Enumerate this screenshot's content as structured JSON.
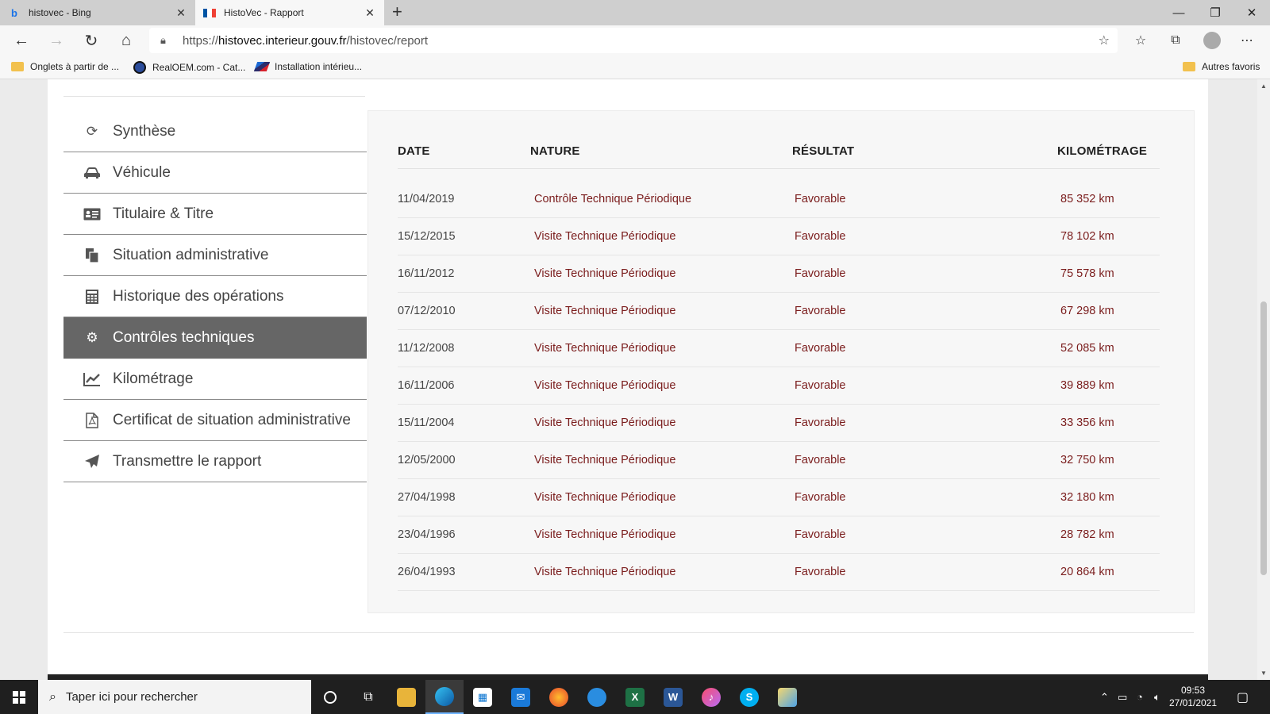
{
  "browser": {
    "tabs": [
      {
        "title": "histovec - Bing",
        "favicon": "bing-icon",
        "active": false
      },
      {
        "title": "HistoVec - Rapport",
        "favicon": "french-flag-icon",
        "active": true
      }
    ],
    "url": {
      "scheme": "https://",
      "host": "histovec.interieur.gouv.fr",
      "path": "/histovec/report"
    },
    "favorites": [
      {
        "label": "Onglets à partir de ...",
        "icon": "folder-icon"
      },
      {
        "label": "RealOEM.com - Cat...",
        "icon": "bmw-icon"
      },
      {
        "label": "Installation intérieu...",
        "icon": "m-stripes-icon"
      }
    ],
    "other_favorites": "Autres favoris"
  },
  "sidebar": {
    "items": [
      {
        "label": "Synthèse",
        "icon": "refresh-icon",
        "active": false
      },
      {
        "label": "Véhicule",
        "icon": "car-icon",
        "active": false
      },
      {
        "label": "Titulaire & Titre",
        "icon": "id-card-icon",
        "active": false
      },
      {
        "label": "Situation administrative",
        "icon": "document-copy-icon",
        "active": false
      },
      {
        "label": "Historique des opérations",
        "icon": "calculator-icon",
        "active": false
      },
      {
        "label": "Contrôles techniques",
        "icon": "gears-icon",
        "active": true
      },
      {
        "label": "Kilométrage",
        "icon": "line-chart-icon",
        "active": false
      },
      {
        "label": "Certificat de situation administrative",
        "icon": "pdf-icon",
        "active": false
      },
      {
        "label": "Transmettre le rapport",
        "icon": "paper-plane-icon",
        "active": false
      }
    ]
  },
  "table": {
    "headers": {
      "date": "DATE",
      "nature": "NATURE",
      "result": "RÉSULTAT",
      "mileage": "KILOMÉTRAGE"
    },
    "rows": [
      {
        "date": "11/04/2019",
        "nature": "Contrôle Technique Périodique",
        "result": "Favorable",
        "mileage": "85 352 km"
      },
      {
        "date": "15/12/2015",
        "nature": "Visite Technique Périodique",
        "result": "Favorable",
        "mileage": "78 102 km"
      },
      {
        "date": "16/11/2012",
        "nature": "Visite Technique Périodique",
        "result": "Favorable",
        "mileage": "75 578 km"
      },
      {
        "date": "07/12/2010",
        "nature": "Visite Technique Périodique",
        "result": "Favorable",
        "mileage": "67 298 km"
      },
      {
        "date": "11/12/2008",
        "nature": "Visite Technique Périodique",
        "result": "Favorable",
        "mileage": "52 085 km"
      },
      {
        "date": "16/11/2006",
        "nature": "Visite Technique Périodique",
        "result": "Favorable",
        "mileage": "39 889 km"
      },
      {
        "date": "15/11/2004",
        "nature": "Visite Technique Périodique",
        "result": "Favorable",
        "mileage": "33 356 km"
      },
      {
        "date": "12/05/2000",
        "nature": "Visite Technique Périodique",
        "result": "Favorable",
        "mileage": "32 750 km"
      },
      {
        "date": "27/04/1998",
        "nature": "Visite Technique Périodique",
        "result": "Favorable",
        "mileage": "32 180 km"
      },
      {
        "date": "23/04/1996",
        "nature": "Visite Technique Périodique",
        "result": "Favorable",
        "mileage": "28 782 km"
      },
      {
        "date": "26/04/1993",
        "nature": "Visite Technique Périodique",
        "result": "Favorable",
        "mileage": "20 864 km"
      }
    ]
  },
  "taskbar": {
    "search_placeholder": "Taper ici pour rechercher",
    "apps": [
      "cortana-icon",
      "task-view-icon",
      "file-explorer-icon",
      "edge-icon",
      "store-icon",
      "mail-icon",
      "firefox-icon",
      "airline-icon",
      "excel-icon",
      "word-icon",
      "itunes-icon",
      "skype-icon",
      "paint-icon"
    ],
    "time": "09:53",
    "date": "27/01/2021"
  },
  "colors": {
    "accent_text": "#7a1c1c",
    "active_nav_bg": "#666666",
    "panel_bg": "#f7f7f7"
  }
}
